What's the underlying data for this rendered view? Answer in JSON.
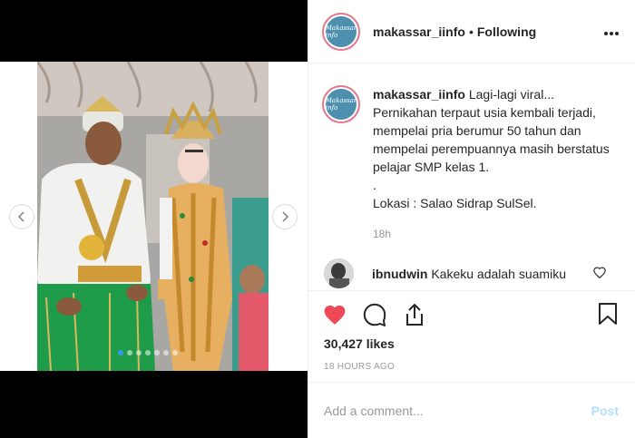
{
  "post": {
    "username": "makassar_iinfo",
    "separator": "•",
    "follow_status": "Following",
    "avatar_text": "Makassar info"
  },
  "caption": {
    "username": "makassar_iinfo",
    "text": "Lagi-lagi viral... Pernikahan terpaut usia kembali terjadi, mempelai pria berumur 50 tahun dan mempelai perempuannya masih berstatus pelajar SMP kelas 1.\n.\nLokasi : Salao Sidrap SulSel.",
    "time": "18h"
  },
  "comments": [
    {
      "username": "ibnudwin",
      "text": "Kakeku adalah suamiku"
    }
  ],
  "stats": {
    "likes": "30,427 likes",
    "posted_ago": "18 HOURS AGO"
  },
  "composer": {
    "placeholder": "Add a comment...",
    "post_label": "Post"
  },
  "carousel": {
    "count": 7,
    "active_index": 0
  },
  "colors": {
    "like_red": "#ed4956",
    "carousel_active": "#3897f0",
    "post_disabled": "#b2dffc"
  },
  "icons": [
    "chevron-left-icon",
    "chevron-right-icon",
    "more-icon",
    "heart-icon",
    "comment-icon",
    "share-icon",
    "bookmark-icon",
    "small-heart-icon"
  ]
}
